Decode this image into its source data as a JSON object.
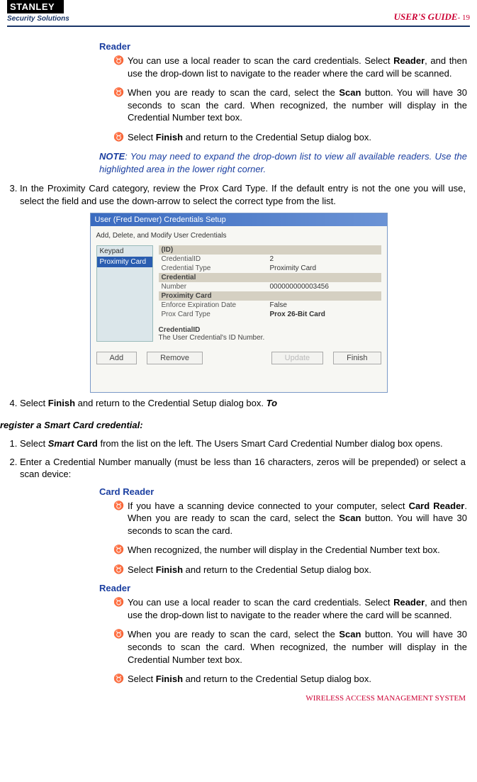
{
  "header": {
    "logo_top": "STANLEY",
    "logo_sub": "Security Solutions",
    "right_label": "USER'S GUIDE",
    "pagenum": "- 19"
  },
  "reader1": {
    "heading": "Reader",
    "b1_a": "You can use a local reader to scan the card credentials.   Select ",
    "b1_bold": "Reader",
    "b1_b": ", and then use the drop-down list to navigate to the reader where the card will be scanned.",
    "b2_a": "When you are ready to scan the card, select the ",
    "b2_bold": "Scan",
    "b2_b": " button.   You will have 30 seconds to scan the card.   When recognized, the number will display in the Credential Number text box.",
    "b3_a": "Select ",
    "b3_bold": "Finish",
    "b3_b": " and return to the Credential Setup dialog box."
  },
  "note": {
    "label": "NOTE",
    "text": ":    You may need to expand the drop-down list to view all available readers. Use the highlighted area in the lower right corner."
  },
  "step3": {
    "text": "In the Proximity Card category, review the Prox Card Type.   If the default entry is not the one you will use, select the field and use the down-arrow to select the correct type from the list."
  },
  "dialog": {
    "title": "User (Fred Denver) Credentials Setup",
    "subtitle": "Add, Delete, and Modify User Credentials",
    "left_item1": "Keypad",
    "left_item2": "Proximity Card",
    "g1": "(ID)",
    "g1k": "CredentialID",
    "g1v": "2",
    "g1k2": "Credential Type",
    "g1v2": "Proximity Card",
    "g2": "Credential",
    "g2k": "Number",
    "g2v": "000000000003456",
    "g3": "Proximity Card",
    "g3k": "Enforce Expiration Date",
    "g3v": "False",
    "g3k2": "Prox Card Type",
    "g3v2": "Prox 26-Bit Card",
    "desc_t": "CredentialID",
    "desc_b": "The User Credential's ID Number.",
    "btn_add": "Add",
    "btn_remove": "Remove",
    "btn_update": "Update",
    "btn_finish": "Finish"
  },
  "step4": {
    "a": "Select ",
    "bold": "Finish",
    "b": " and return to the Credential Setup dialog box. ",
    "trail_bold_italic": "To"
  },
  "register_heading": "register a Smart Card credential:",
  "sc_step1": {
    "a": "Select ",
    "bold": "Smart Card",
    "b": " from the list on the left.   The Users Smart Card Credential Number dialog box opens."
  },
  "sc_step2": {
    "text": "Enter a Credential Number manually (must be less than 16 characters, zeros will be prepended) or select a scan device:"
  },
  "cardreader": {
    "heading": "Card Reader",
    "b1_a": "If you have a scanning device connected to your computer, select ",
    "b1_bold": "Card Reader",
    "b1_b": ".   When you are ready to scan the card, select the ",
    "b1_bold2": "Scan",
    "b1_c": " button. You will have 30 seconds to scan the card.",
    "b2": "When recognized, the number will display in the Credential Number text box.",
    "b3_a": "Select ",
    "b3_bold": "Finish",
    "b3_b": " and return to the Credential Setup dialog box."
  },
  "reader2": {
    "heading": "Reader",
    "b1_a": "You can use a local reader to scan the card credentials.   Select ",
    "b1_bold": "Reader",
    "b1_b": ", and then use the drop-down list to navigate to the reader where the card will be scanned.",
    "b2_a": "When you are ready to scan the card, select the ",
    "b2_bold": "Scan",
    "b2_b": " button.   You will have 30 seconds to scan the card.   When recognized, the number will display in the Credential Number text box.",
    "b3_a": "Select ",
    "b3_bold": "Finish",
    "b3_b": " and return to the Credential Setup dialog box."
  },
  "footer": "WIRELESS ACCESS MANAGEMENT SYSTEM"
}
